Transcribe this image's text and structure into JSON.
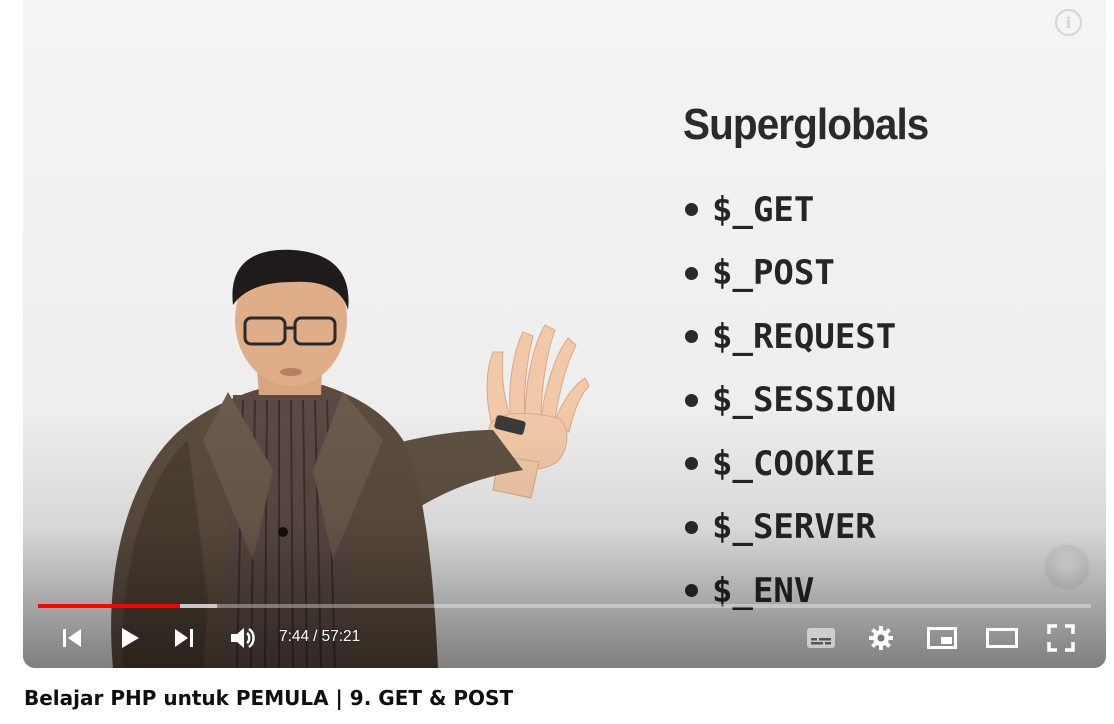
{
  "player": {
    "slide": {
      "title": "Superglobals",
      "items": [
        "$_GET",
        "$_POST",
        "$_REQUEST",
        "$_SESSION",
        "$_COOKIE",
        "$_SERVER",
        "$_ENV"
      ]
    },
    "progress": {
      "played_fraction": 0.1348,
      "buffered_fraction": 0.17
    },
    "time": {
      "current": "7:44",
      "separator": "/",
      "duration": "57:21"
    },
    "accent_color": "#ff0000",
    "icons": [
      "info-icon",
      "previous-icon",
      "play-icon",
      "next-icon",
      "volume-icon",
      "subtitles-icon",
      "settings-gear-icon",
      "miniplayer-icon",
      "theater-mode-icon",
      "fullscreen-icon"
    ]
  },
  "video": {
    "title": "Belajar PHP untuk PEMULA | 9. GET & POST"
  }
}
